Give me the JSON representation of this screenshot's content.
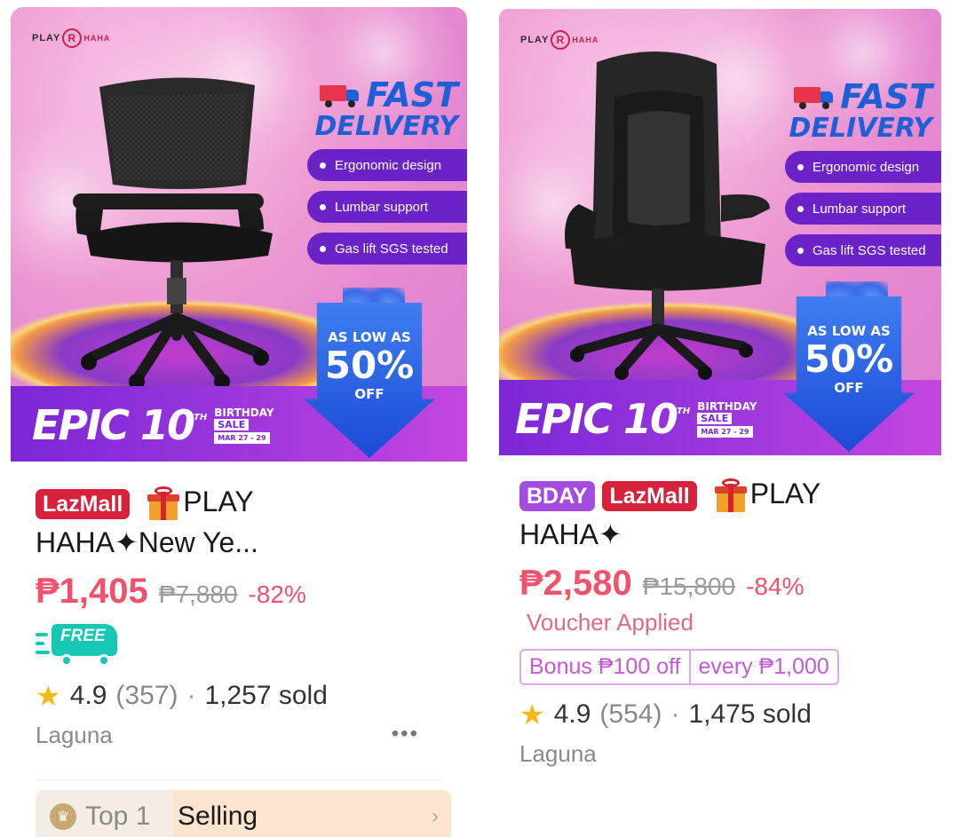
{
  "products": [
    {
      "brand": "PLAY HAHA",
      "fast_delivery": [
        "FAST",
        "DELIVERY"
      ],
      "features": [
        "Ergonomic design",
        "Lumbar support",
        "Gas lift SGS tested"
      ],
      "sale_banner": {
        "epic": "EPIC 10",
        "th": "TH",
        "birthday": "BIRTHDAY",
        "sale": "SALE",
        "dates": "MAR 27 - 29"
      },
      "promo": {
        "line1": "AS LOW AS",
        "line2": "50%",
        "line3": "OFF"
      },
      "badges": [
        "LazMall"
      ],
      "title_1": "PLAY",
      "title_2": "HAHA✦New Ye...",
      "price": "₱1,405",
      "original_price": "₱7,880",
      "discount": "-82%",
      "free_shipping": "FREE",
      "rating": "4.9",
      "review_count": "(357)",
      "separator": "·",
      "sold": "1,257 sold",
      "location": "Laguna",
      "more": "•••",
      "top_label": "Top 1",
      "top_value": "Selling",
      "top_chevron": "›"
    },
    {
      "brand": "PLAY HAHA",
      "fast_delivery": [
        "FAST",
        "DELIVERY"
      ],
      "features": [
        "Ergonomic design",
        "Lumbar support",
        "Gas lift SGS tested"
      ],
      "sale_banner": {
        "epic": "EPIC 10",
        "th": "TH",
        "birthday": "BIRTHDAY",
        "sale": "SALE",
        "dates": "MAR 27 - 29"
      },
      "promo": {
        "line1": "AS LOW AS",
        "line2": "50%",
        "line3": "OFF"
      },
      "badges": [
        "BDAY",
        "LazMall"
      ],
      "title_1": "PLAY",
      "title_2": "HAHA✦",
      "price": "₱2,580",
      "original_price": "₱15,800",
      "discount": "-84%",
      "voucher": "Voucher Applied",
      "bonus": [
        "Bonus ₱100 off",
        "every ₱1,000"
      ],
      "rating": "4.9",
      "review_count": "(554)",
      "separator": "·",
      "sold": "1,475 sold",
      "location": "Laguna"
    }
  ],
  "colors": {
    "price": "#f0516b",
    "lazmall": "#d8213b",
    "bday": "#a54ce0",
    "star": "#f5b919",
    "free": "#16c8b4"
  },
  "icons": [
    "truck-icon",
    "gift-icon",
    "star-icon",
    "more-icon",
    "trophy-icon",
    "chevron-right-icon",
    "free-shipping-icon"
  ]
}
